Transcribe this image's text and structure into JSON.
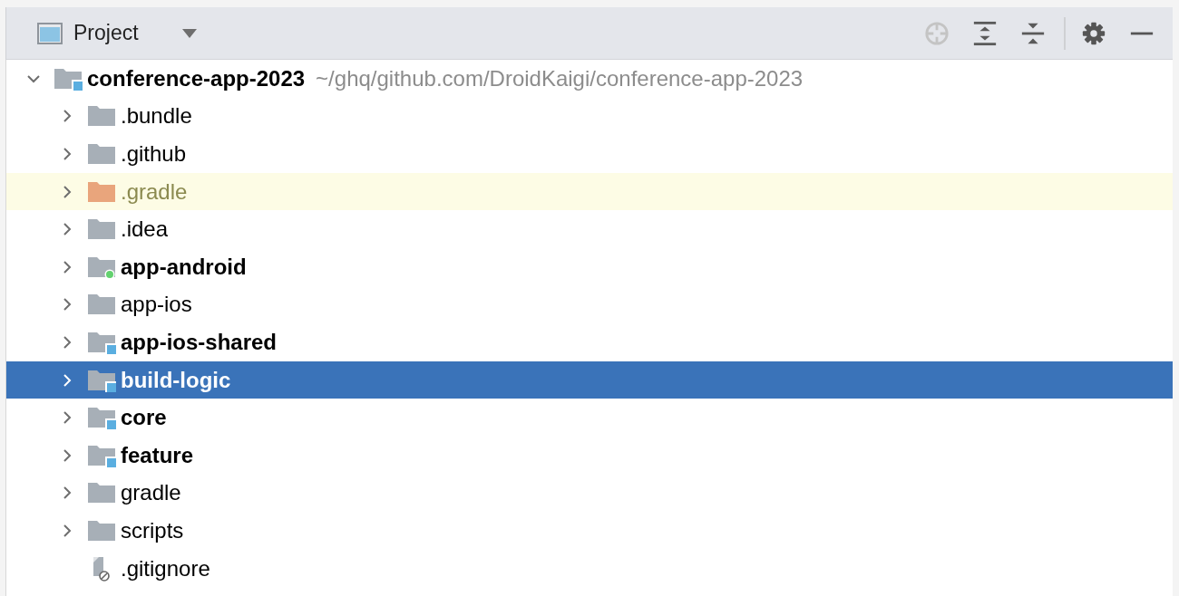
{
  "panel": {
    "title": "Project"
  },
  "project_tree": [
    {
      "name": "conference-app-2023",
      "path": "~/ghq/github.com/DroidKaigi/conference-app-2023",
      "kind": "module",
      "expanded": true,
      "selected": false,
      "excluded": false,
      "children": [
        {
          "name": ".bundle",
          "kind": "folder",
          "expanded": false,
          "selected": false,
          "excluded": false
        },
        {
          "name": ".github",
          "kind": "folder",
          "expanded": false,
          "selected": false,
          "excluded": false
        },
        {
          "name": ".gradle",
          "kind": "folder",
          "expanded": false,
          "selected": false,
          "excluded": true
        },
        {
          "name": ".idea",
          "kind": "folder",
          "expanded": false,
          "selected": false,
          "excluded": false
        },
        {
          "name": "app-android",
          "kind": "android",
          "expanded": false,
          "selected": false,
          "excluded": false
        },
        {
          "name": "app-ios",
          "kind": "folder",
          "expanded": false,
          "selected": false,
          "excluded": false
        },
        {
          "name": "app-ios-shared",
          "kind": "module",
          "expanded": false,
          "selected": false,
          "excluded": false
        },
        {
          "name": "build-logic",
          "kind": "module",
          "expanded": false,
          "selected": true,
          "excluded": false
        },
        {
          "name": "core",
          "kind": "module",
          "expanded": false,
          "selected": false,
          "excluded": false
        },
        {
          "name": "feature",
          "kind": "module",
          "expanded": false,
          "selected": false,
          "excluded": false
        },
        {
          "name": "gradle",
          "kind": "folder",
          "expanded": false,
          "selected": false,
          "excluded": false
        },
        {
          "name": "scripts",
          "kind": "folder",
          "expanded": false,
          "selected": false,
          "excluded": false
        },
        {
          "name": ".gitignore",
          "kind": "file",
          "selected": false,
          "excluded": false
        }
      ]
    }
  ]
}
